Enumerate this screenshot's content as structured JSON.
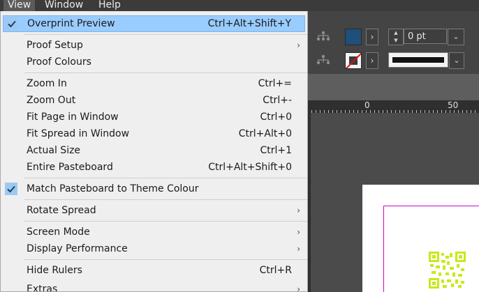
{
  "menubar": {
    "items": [
      {
        "label": "View",
        "active": true
      },
      {
        "label": "Window"
      },
      {
        "label": "Help"
      }
    ]
  },
  "view_menu": {
    "overprint_preview": {
      "label": "Overprint Preview",
      "shortcut": "Ctrl+Alt+Shift+Y",
      "checked": true
    },
    "proof_setup": {
      "label": "Proof Setup",
      "submenu": true
    },
    "proof_colours": {
      "label": "Proof Colours"
    },
    "zoom_in": {
      "label": "Zoom In",
      "shortcut": "Ctrl+="
    },
    "zoom_out": {
      "label": "Zoom Out",
      "shortcut": "Ctrl+-"
    },
    "fit_page": {
      "label": "Fit Page in Window",
      "shortcut": "Ctrl+0"
    },
    "fit_spread": {
      "label": "Fit Spread in Window",
      "shortcut": "Ctrl+Alt+0"
    },
    "actual_size": {
      "label": "Actual Size",
      "shortcut": "Ctrl+1"
    },
    "entire_pasteboard": {
      "label": "Entire Pasteboard",
      "shortcut": "Ctrl+Alt+Shift+0"
    },
    "match_pasteboard": {
      "label": "Match Pasteboard to Theme Colour",
      "checked": true
    },
    "rotate_spread": {
      "label": "Rotate Spread",
      "submenu": true
    },
    "screen_mode": {
      "label": "Screen Mode",
      "submenu": true
    },
    "display_performance": {
      "label": "Display Performance",
      "submenu": true
    },
    "hide_rulers": {
      "label": "Hide Rulers",
      "shortcut": "Ctrl+R"
    },
    "extras": {
      "label": "Extras",
      "submenu": true
    }
  },
  "control_panel": {
    "stroke_weight": "0 pt",
    "fill_color": "#1f4f7a"
  },
  "ruler": {
    "labels": [
      "0",
      "50"
    ]
  },
  "icons": {
    "checkmark": "checkmark-icon",
    "submenu": "chevron-right-icon",
    "dropdown": "chevron-down-icon",
    "spinner": "spinner-arrows-icon"
  }
}
